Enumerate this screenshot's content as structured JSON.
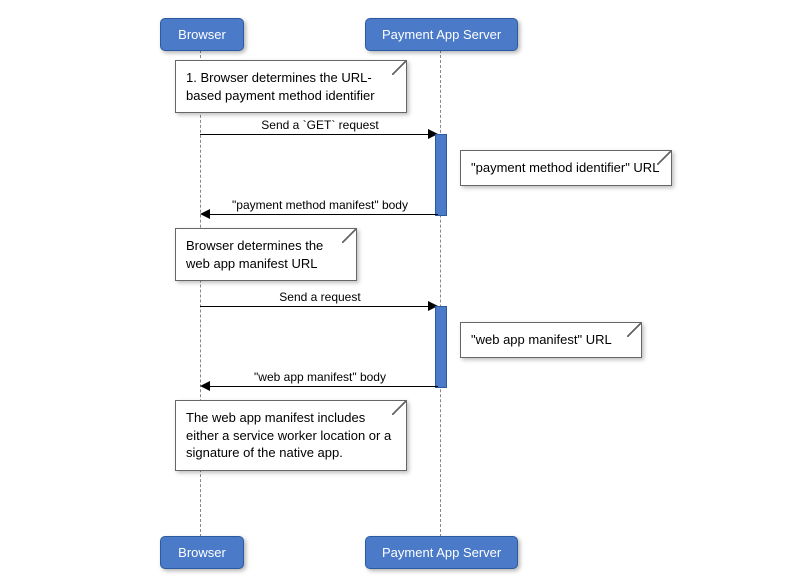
{
  "participants": {
    "browser": "Browser",
    "server": "Payment App Server"
  },
  "notes": {
    "n1": "1. Browser determines the URL-based payment method identifier",
    "n2": "\"payment method identifier\" URL",
    "n3": "Browser determines the web app manifest URL",
    "n4": "\"web app manifest\" URL",
    "n5": "The web app manifest includes either a service worker location or a signature of the native app."
  },
  "messages": {
    "m1": "Send a `GET` request",
    "m2": "\"payment method manifest\" body",
    "m3": "Send a request",
    "m4": "\"web app manifest\" body"
  }
}
